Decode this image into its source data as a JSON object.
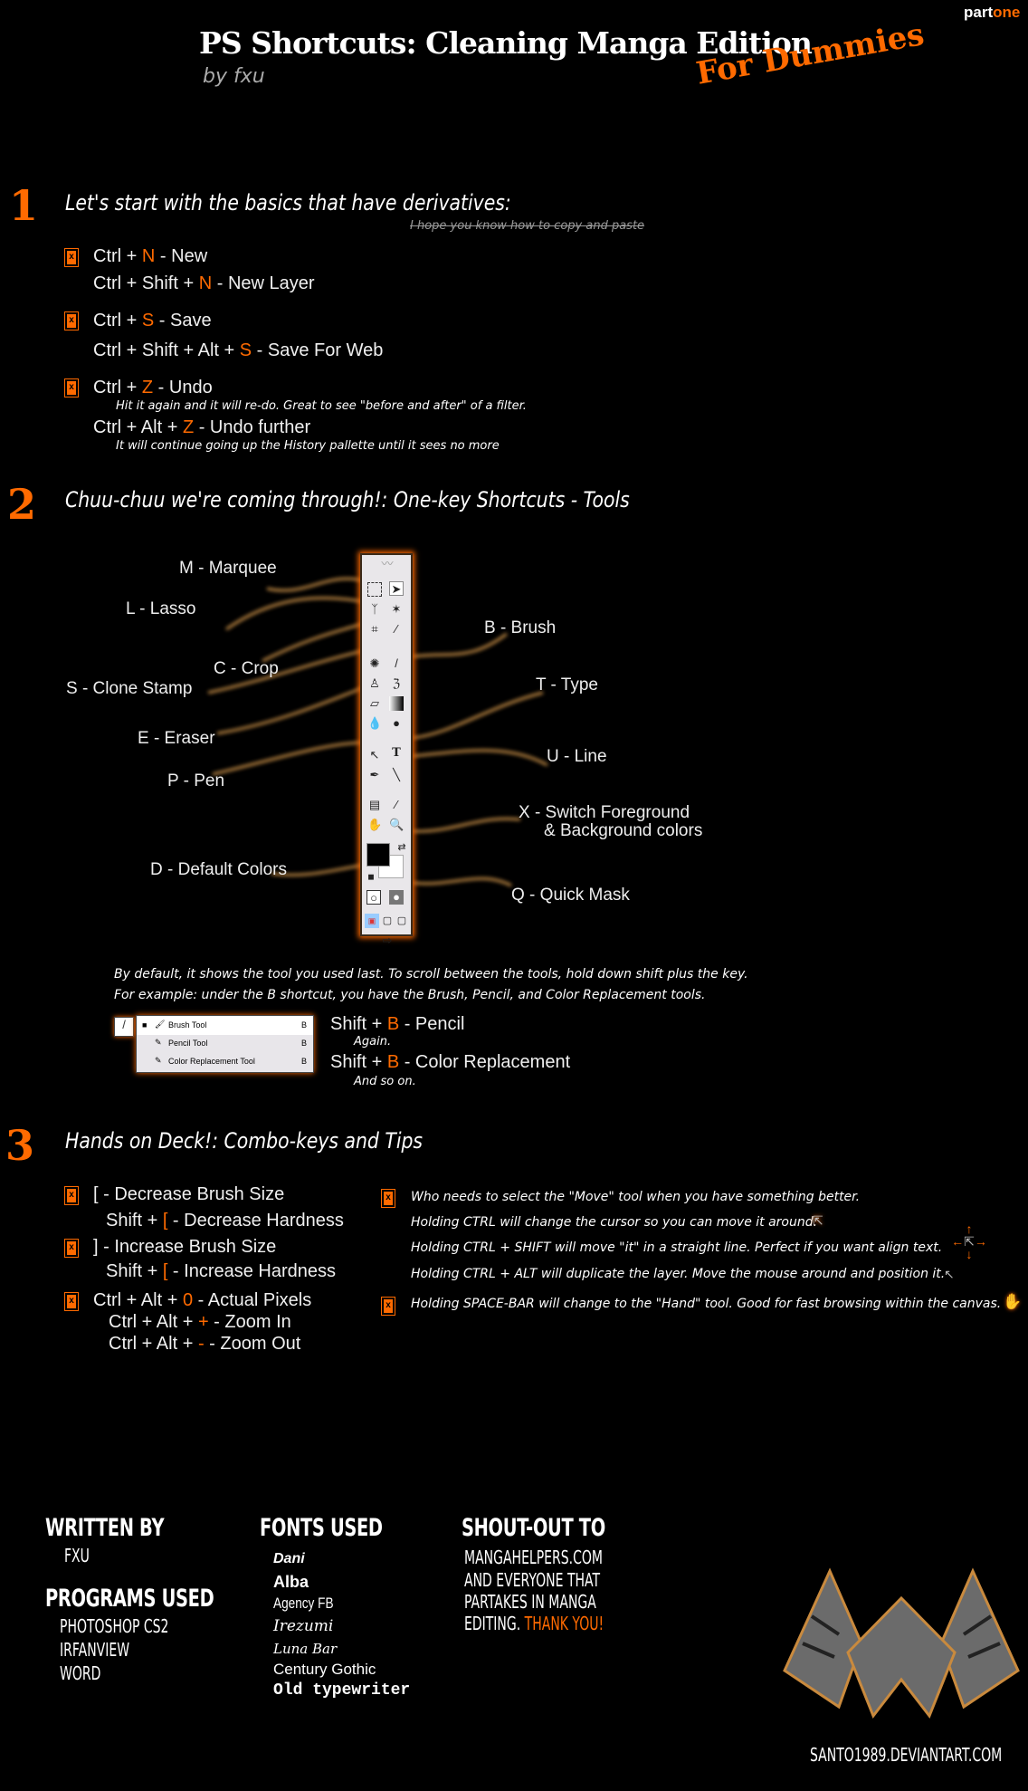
{
  "header": {
    "part": "part",
    "part_accent": "one",
    "title": "PS Shortcuts: Cleaning Manga Edition",
    "byline": "by fxu",
    "subtitle": "For Dummies"
  },
  "section1": {
    "number": "1",
    "heading": "Let's start with the basics that have derivatives:",
    "struck_note": "I hope you know how to copy and paste",
    "items": [
      {
        "pre": "Ctrl + ",
        "key": "N",
        "post": " - New"
      },
      {
        "pre": "Ctrl + Shift + ",
        "key": "N",
        "post": " - New Layer"
      },
      {
        "pre": "Ctrl + ",
        "key": "S",
        "post": " - Save"
      },
      {
        "pre": "Ctrl + Shift + Alt + ",
        "key": "S",
        "post": " - Save For Web"
      },
      {
        "pre": "Ctrl + ",
        "key": "Z",
        "post": " - Undo",
        "note": "Hit it again and it will re-do. Great to see \"before and after\" of a filter."
      },
      {
        "pre": "Ctrl + Alt + ",
        "key": "Z",
        "post": " - Undo further",
        "note": "It will continue going up the History pallette until it sees no more"
      }
    ]
  },
  "section2": {
    "number": "2",
    "heading": "Chuu-chuu we're coming through!: One-key Shortcuts - Tools",
    "labels": {
      "marquee": "M - Marquee",
      "lasso": "L - Lasso",
      "crop": "C - Crop",
      "clone": "S - Clone Stamp",
      "eraser": "E - Eraser",
      "pen": "P - Pen",
      "default_colors": "D - Default Colors",
      "brush": "B - Brush",
      "type": "T - Type",
      "line": "U - Line",
      "switch1": "X - Switch Foreground",
      "switch2": "& Background colors",
      "quickmask": "Q - Quick Mask"
    },
    "para1": "By default, it shows the tool you used last. To scroll between the tools, hold down shift plus the key.",
    "para2": "For example: under the B shortcut, you have the Brush, Pencil, and Color Replacement tools.",
    "flyout": [
      {
        "name": "Brush Tool",
        "key": "B"
      },
      {
        "name": "Pencil Tool",
        "key": "B"
      },
      {
        "name": "Color Replacement Tool",
        "key": "B"
      }
    ],
    "shift1": {
      "pre": "Shift + ",
      "key": "B",
      "post": " - Pencil",
      "note": "Again."
    },
    "shift2": {
      "pre": "Shift + ",
      "key": "B",
      "post": " - Color Replacement",
      "note": "And so on."
    }
  },
  "section3": {
    "number": "3",
    "heading": "Hands on Deck!: Combo-keys and Tips",
    "left": [
      {
        "pre": "[ - Decrease Brush Size"
      },
      {
        "pre": "Shift + ",
        "key": "[",
        "post": " - Decrease Hardness"
      },
      {
        "pre": "] - Increase Brush Size"
      },
      {
        "pre": "Shift + ",
        "key": "[",
        "post": " - Increase Hardness"
      },
      {
        "pre": "Ctrl + Alt + ",
        "key": "0",
        "post": " - Actual Pixels"
      },
      {
        "pre": "Ctrl + Alt + ",
        "key": "+",
        "post": " - Zoom In"
      },
      {
        "pre": "Ctrl + Alt + ",
        "key": "-",
        "post": " - Zoom Out"
      }
    ],
    "right": [
      "Who needs to select the \"Move\" tool when you have something better.",
      "Holding CTRL will change the cursor so you can move it around.",
      "Holding CTRL + SHIFT will move \"it\" in a straight line. Perfect if you want align text.",
      "Holding CTRL + ALT will duplicate the layer. Move the mouse around and position it.",
      "Holding SPACE-BAR will change to the \"Hand\" tool. Good for fast browsing within the canvas."
    ]
  },
  "footer": {
    "written_by": "WRITTEN BY",
    "author": "FXU",
    "programs_used": "PROGRAMS USED",
    "programs": [
      "PHOTOSHOP CS2",
      "IRFANVIEW",
      "WORD"
    ],
    "fonts_used": "FONTS USED",
    "fonts": [
      "Dani",
      "Alba",
      "Agency FB",
      "Irezumi",
      "Luna Bar",
      "Century Gothic",
      "Old typewriter"
    ],
    "shout_out": "SHOUT-OUT TO",
    "shout_lines": [
      "MANGAHELPERS.COM",
      "AND EVERYONE THAT",
      "PARTAKES IN MANGA"
    ],
    "shout_last": "EDITING. ",
    "thanks": "THANK YOU!",
    "signature": "SANTO1989.DEVIANTART.COM"
  },
  "colors": {
    "accent": "#ff6a00",
    "background": "#000000",
    "text": "#ffffff"
  }
}
